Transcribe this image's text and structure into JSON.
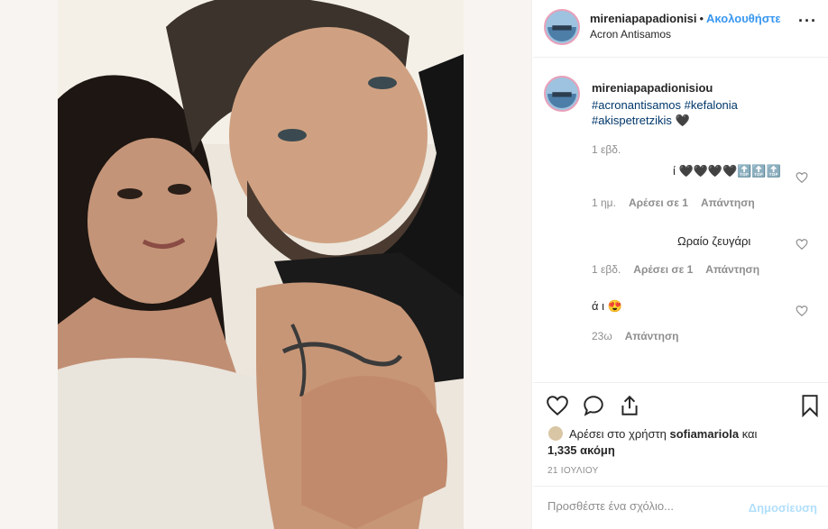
{
  "post": {
    "username": "mireniapapadionisi",
    "separator": "•",
    "follow_label": "Ακολουθήστε",
    "location": "Acron Antisamos",
    "more_label": "···"
  },
  "caption": {
    "username": "mireniapapadionisiou",
    "hashtags_line1a": "#acronantisamos",
    "hashtags_line1b": "#kefalonia",
    "hashtags_line2": "#akispetretzikis 🖤",
    "time": "1 εβδ."
  },
  "comments": [
    {
      "text": "ί 🖤🖤🖤🖤🔝🔝🔝",
      "time": "1 ημ.",
      "likes": "Αρέσει σε 1",
      "reply": "Απάντηση"
    },
    {
      "text": "Ωραίο ζευγάρι",
      "time": "1 εβδ.",
      "likes": "Αρέσει σε 1",
      "reply": "Απάντηση"
    },
    {
      "text": "ά               ι 😍",
      "time": "23ω",
      "reply": "Απάντηση"
    }
  ],
  "likes": {
    "prefix": "Αρέσει στο χρήστη",
    "user": "sofiamariola",
    "and": "και",
    "count": "1,335 ακόμη"
  },
  "date": "21 ΙΟΥΛΙΟΥ",
  "add_comment": {
    "placeholder": "Προσθέστε ένα σχόλιο...",
    "post_label": "Δημοσίευση"
  },
  "icons": {
    "like": "heart-icon",
    "comment": "comment-icon",
    "share": "share-icon",
    "save": "bookmark-icon",
    "comment_like": "heart-small-icon"
  },
  "colors": {
    "link": "#3897f0",
    "hashtag": "#00376b",
    "muted": "#8e8e8e",
    "text": "#262626",
    "post_disabled": "#b2dffc"
  }
}
